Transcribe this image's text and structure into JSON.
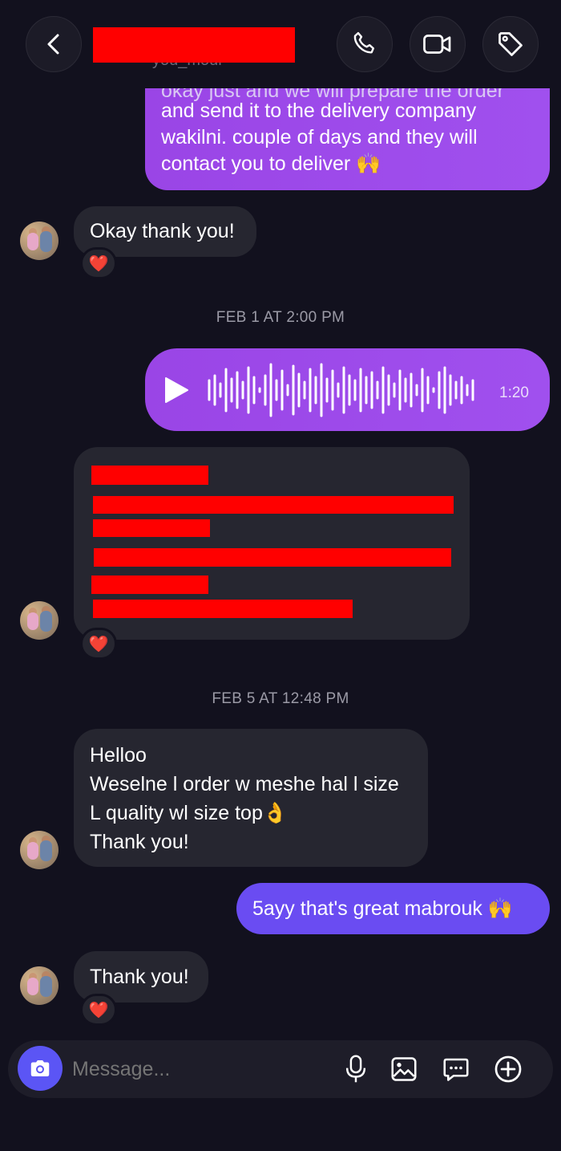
{
  "header": {
    "username_partial": "you_mour"
  },
  "messages": {
    "m1_partial_top": "okay just and we will prepare the order",
    "m1_line1": "and send it to the delivery company",
    "m1_line2": "wakilni. couple of days and they will",
    "m1_line3": "contact you to deliver 🙌",
    "m2": "Okay thank you!",
    "m2_reaction": "❤️",
    "ts1": "FEB 1 AT 2:00 PM",
    "voice_duration": "1:20",
    "m4_reaction": "❤️",
    "ts2": "FEB 5 AT 12:48 PM",
    "m5_line1": "Helloo",
    "m5_line2": "Weselne l order w meshe hal l size",
    "m5_line3": "L quality wl size top👌",
    "m5_line4": "Thank you!",
    "m6": "5ayy that's great mabrouk 🙌",
    "m7": "Thank you!",
    "m7_reaction": "❤️"
  },
  "composer": {
    "placeholder": "Message..."
  },
  "colors": {
    "background": "#12111e",
    "incoming_bubble": "#262630",
    "outgoing_bubble": "#9a45e6",
    "outgoing_blue": "#6a4cf2",
    "redaction": "#ff0000"
  }
}
